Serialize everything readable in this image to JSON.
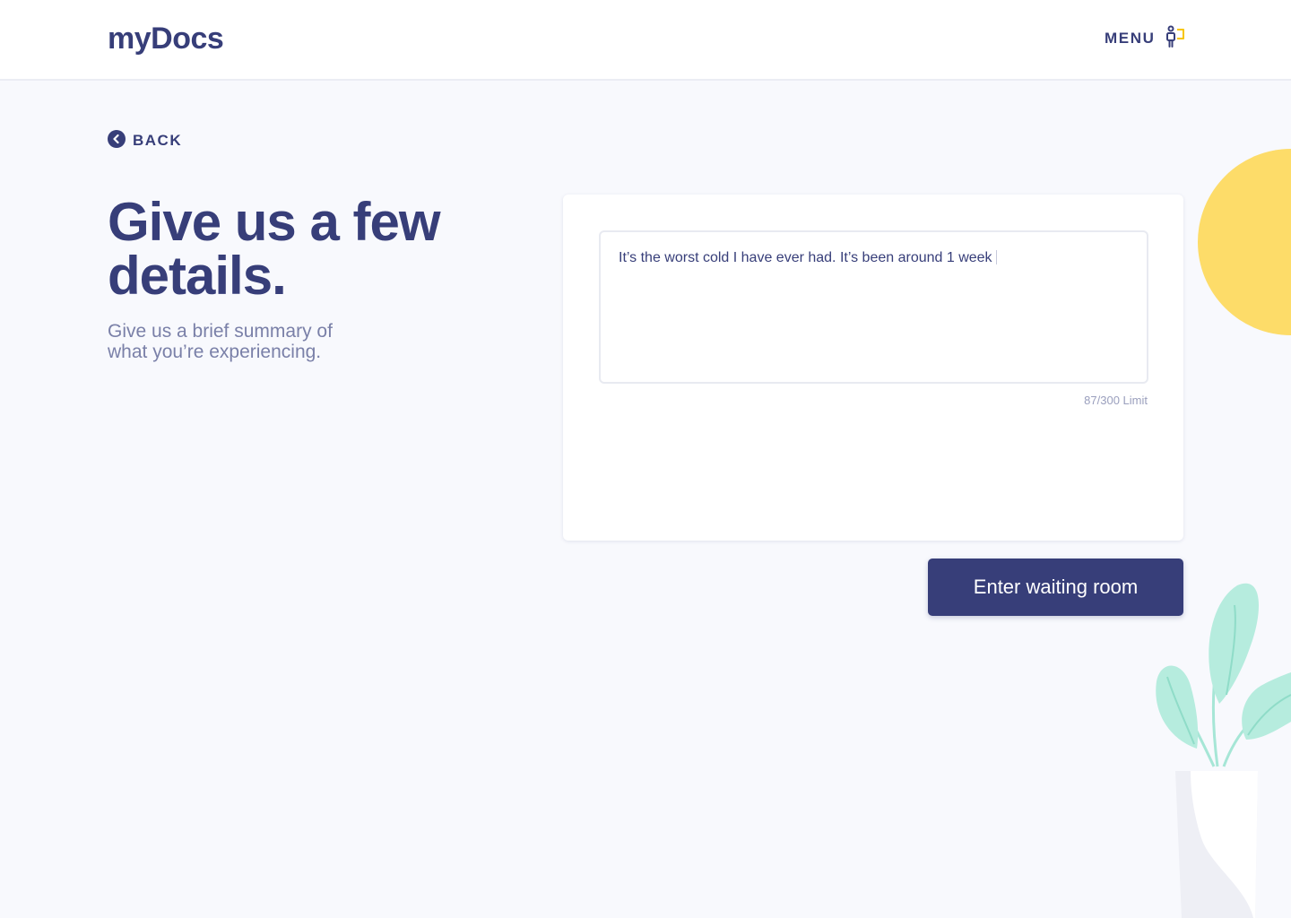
{
  "header": {
    "logo": "myDocs",
    "menu_label": "MENU"
  },
  "back": {
    "label": "BACK"
  },
  "intro": {
    "title": "Give us a few details.",
    "subtitle": "Give us a brief summary of what you’re experiencing."
  },
  "form": {
    "summary_value": "It’s the worst cold I have ever had. It’s been around 1 week",
    "char_limit": "87/300 Limit",
    "submit_label": "Enter waiting room"
  },
  "colors": {
    "primary": "#373e79",
    "accent_yellow": "#fddc69",
    "leaf_mint": "#b6ecde",
    "background": "#f8f9fd"
  }
}
